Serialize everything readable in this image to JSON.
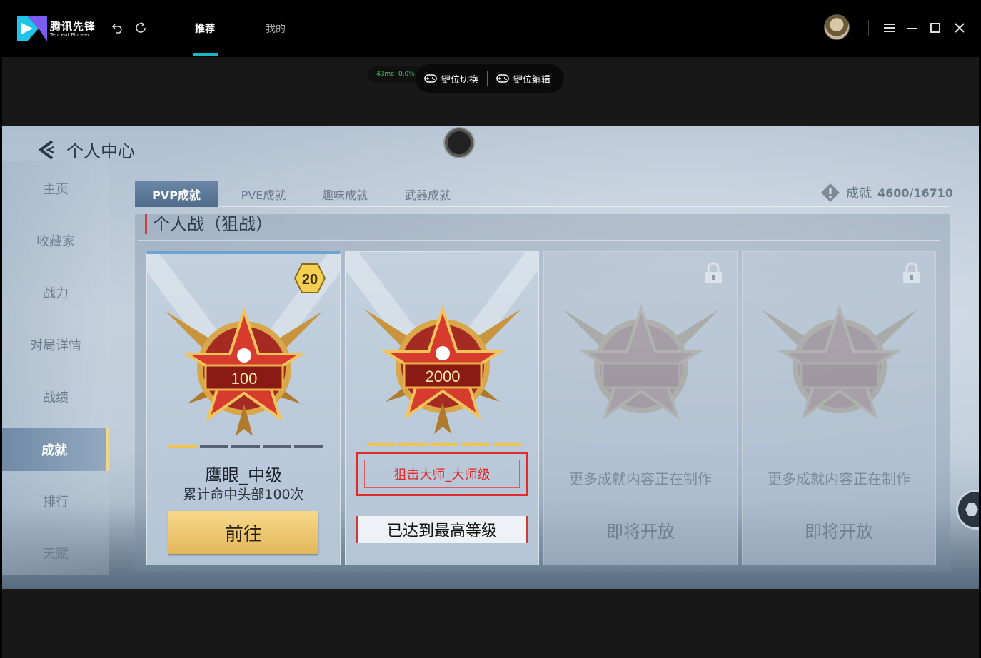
{
  "app": {
    "logo_cn": "腾讯先锋",
    "logo_en": "Tencent Pioneer",
    "nav": [
      {
        "label": "推荐",
        "active": true
      },
      {
        "label": "我的",
        "active": false
      }
    ],
    "accent_color": "#19b8c9"
  },
  "toolbar": {
    "latency": "43ms",
    "loss": "0.0%",
    "key_switch_label": "键位切换",
    "key_edit_label": "键位编辑"
  },
  "game": {
    "page_title": "个人中心",
    "sidebar": [
      "主页",
      "收藏家",
      "战力",
      "对局详情",
      "战绩",
      "成就",
      "排行",
      "天赋"
    ],
    "sidebar_active": "成就",
    "tabs": [
      "PVP成就",
      "PVE成就",
      "趣味成就",
      "武器成就"
    ],
    "achievement_label": "成就",
    "achievement_count": "4600/16710",
    "section_title": "个人战（狙战）",
    "cards": [
      {
        "badge_number": "100",
        "level": "20",
        "progress": 1,
        "progress_total": 5,
        "name": "鹰眼_中级",
        "desc": "累计命中头部100次",
        "action_label": "前往"
      },
      {
        "badge_number": "2000",
        "progress": 5,
        "progress_total": 5,
        "name": "狙击大师_大师级",
        "status_label": "已达到最高等级"
      },
      {
        "locked": true,
        "line1": "更多成就内容正在制作",
        "line2": "即将开放"
      },
      {
        "locked": true,
        "line1": "更多成就内容正在制作",
        "line2": "即将开放"
      }
    ]
  }
}
